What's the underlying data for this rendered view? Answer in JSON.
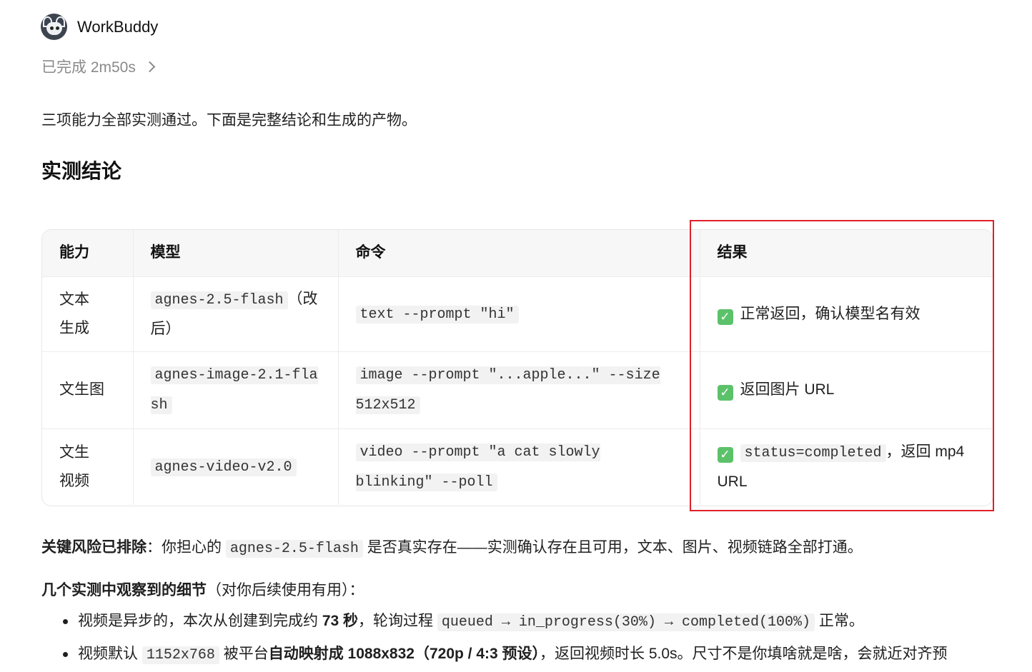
{
  "header": {
    "app_name": "WorkBuddy",
    "status": "已完成 2m50s"
  },
  "intro": "三项能力全部实测通过。下面是完整结论和生成的产物。",
  "section_title": "实测结论",
  "table": {
    "headers": [
      "能力",
      "模型",
      "命令",
      "结果"
    ],
    "rows": [
      {
        "capability": "文本生成",
        "model_code": "agnes-2.5-flash",
        "model_note": "（改后）",
        "command": "text --prompt \"hi\"",
        "result_prefix": "",
        "result": "正常返回，确认模型名有效"
      },
      {
        "capability": "文生图",
        "model_code": "agnes-image-2.1-flash",
        "model_note": "",
        "command": "image --prompt \"...apple...\" --size 512x512",
        "result_prefix": "",
        "result": "返回图片 URL"
      },
      {
        "capability": "文生视频",
        "model_code": "agnes-video-v2.0",
        "model_note": "",
        "command": "video --prompt \"a cat slowly blinking\" --poll",
        "result_prefix": "status=completed",
        "result": "，返回 mp4 URL"
      }
    ]
  },
  "risk": {
    "label": "关键风险已排除",
    "text_a": "：你担心的 ",
    "code": "agnes-2.5-flash",
    "text_b": " 是否真实存在——实测确认存在且可用，文本、图片、视频链路全部打通。"
  },
  "details": {
    "label": "几个实测中观察到的细节",
    "note": "（对你后续使用有用）："
  },
  "bullets": [
    {
      "a": "视频是异步的，本次从创建到完成约 ",
      "bold": "73 秒",
      "b": "，轮询过程 ",
      "code": "queued → in_progress(30%) → completed(100%)",
      "c": " 正常。"
    },
    {
      "a": "视频默认 ",
      "code": "1152x768",
      "b": " 被平台",
      "bold": "自动映射成",
      "c": " 1088x832（720p / 4:3 预设）",
      "d": "，返回视频时长 5.0s。尺寸不是你填啥就是啥，会就近对齐预"
    }
  ]
}
